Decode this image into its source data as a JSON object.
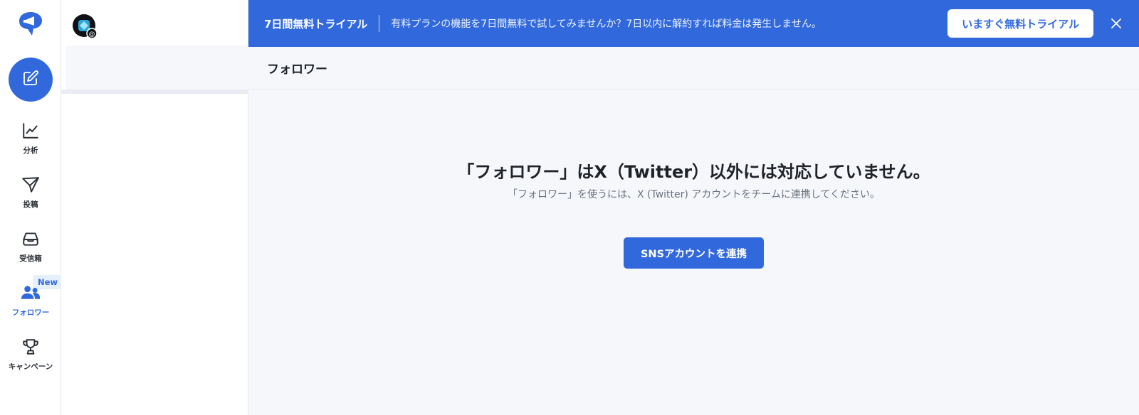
{
  "colors": {
    "accent": "#3169dc",
    "panel_bg": "#f5f7fb",
    "text": "#1f2328",
    "muted": "#6b7280"
  },
  "rail": {
    "logo_icon": "megaphone-logo-icon",
    "compose_icon": "compose-pencil-icon",
    "items": [
      {
        "label": "分析",
        "icon": "chart-line-icon"
      },
      {
        "label": "投稿",
        "icon": "paper-plane-icon"
      },
      {
        "label": "受信箱",
        "icon": "inbox-icon"
      },
      {
        "label": "フォロワー",
        "icon": "users-icon",
        "badge": "New",
        "active": true
      },
      {
        "label": "キャンペーン",
        "icon": "trophy-icon"
      }
    ]
  },
  "account": {
    "icon": "threads-account-avatar-icon"
  },
  "banner": {
    "title": "7日間無料トライアル",
    "text": "有料プランの機能を7日間無料で試してみませんか？7日以内に解約すれば料金は発生しません。",
    "cta": "いますぐ無料トライアル",
    "close_icon": "close-icon"
  },
  "page": {
    "title": "フォロワー"
  },
  "main": {
    "title": "「フォロワー」はX（Twitter）以外には対応していません。",
    "subtitle": "「フォロワー」を使うには、X (Twitter) アカウントをチームに連携してください。",
    "button": "SNSアカウントを連携"
  }
}
